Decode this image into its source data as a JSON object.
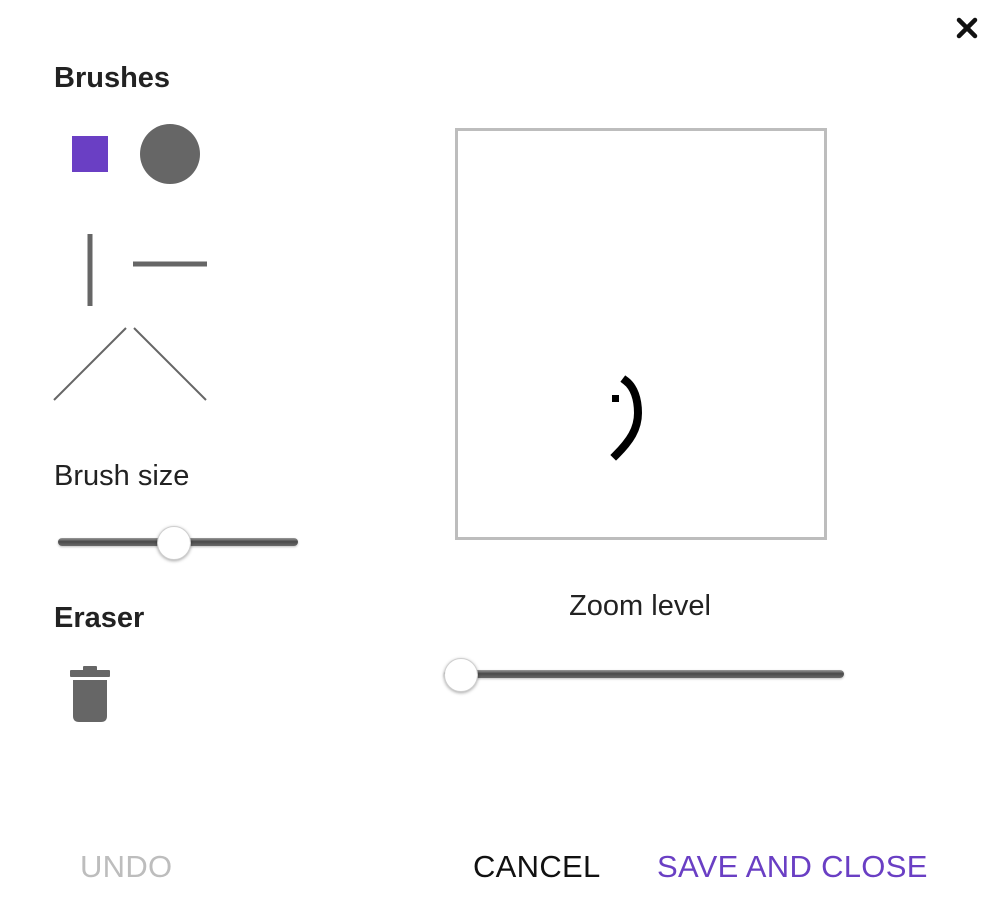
{
  "dialog": {
    "close_icon": "close-icon"
  },
  "brushes": {
    "heading": "Brushes",
    "items": [
      {
        "name": "square",
        "selected": true,
        "color": "#6a3fc4"
      },
      {
        "name": "circle",
        "selected": false,
        "color": "#666666"
      },
      {
        "name": "vertical-line",
        "selected": false,
        "color": "#666666"
      },
      {
        "name": "horizontal-line",
        "selected": false,
        "color": "#666666"
      },
      {
        "name": "diagonal-up",
        "selected": false,
        "color": "#666666"
      },
      {
        "name": "diagonal-down",
        "selected": false,
        "color": "#666666"
      }
    ]
  },
  "brush_size": {
    "label": "Brush size",
    "value_fraction": 0.48
  },
  "eraser": {
    "heading": "Eraser",
    "icon": "trash-icon"
  },
  "zoom": {
    "label": "Zoom level",
    "value_fraction": 0.04
  },
  "actions": {
    "undo_label": "UNDO",
    "cancel_label": "CANCEL",
    "save_label": "SAVE AND CLOSE"
  },
  "colors": {
    "accent": "#6a3fc4",
    "disabled": "#bdbdbd",
    "icon_gray": "#666666",
    "canvas_border": "#bdbdbd"
  }
}
